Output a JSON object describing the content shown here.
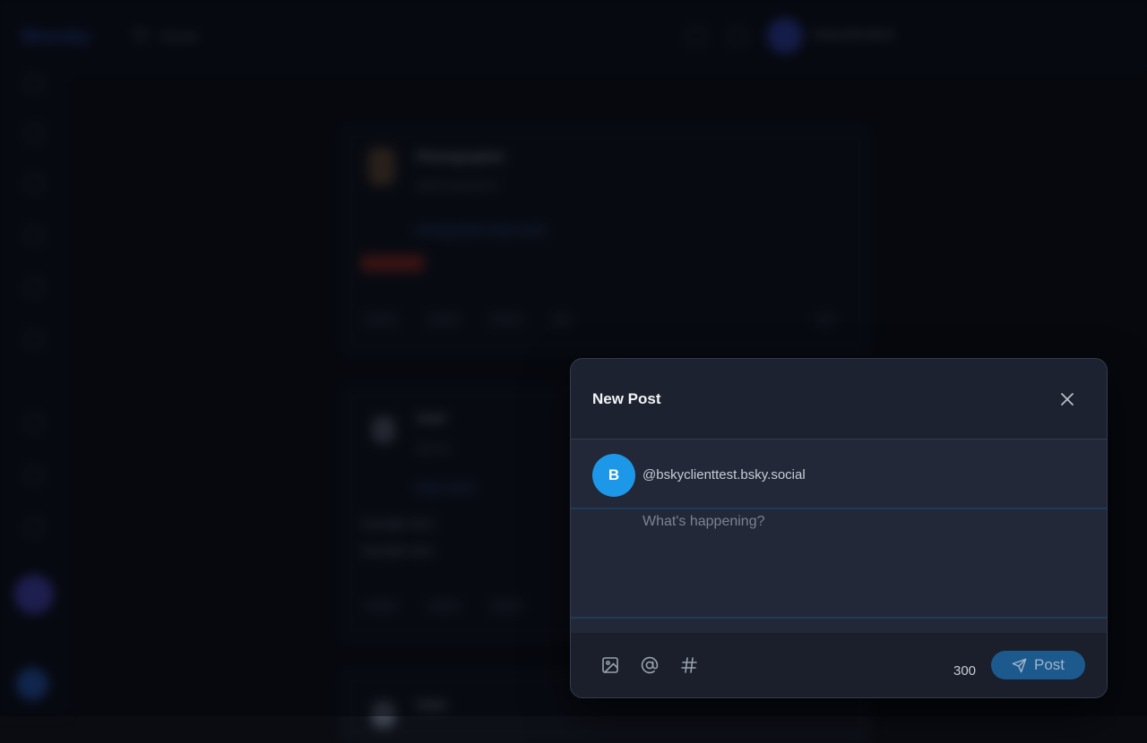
{
  "background": {
    "logo": "Bluesky",
    "breadcrumb": "Home",
    "user_name": "bskyclienttest",
    "posts": [
      {
        "author": "Photographer",
        "handle": "@photographer",
        "link": "photographer.bsky.social"
      },
      {
        "author": "User",
        "handle": "@user",
        "link": "bsky.social",
        "text_1": "Sample text",
        "text_2": "Sample text"
      },
      {
        "author": "User"
      }
    ]
  },
  "dialog": {
    "title": "New Post",
    "close_icon": "close-icon",
    "account": {
      "avatar_initial": "B",
      "handle": "@bskyclienttest.bsky.social"
    },
    "composer": {
      "placeholder": "What's happening?",
      "value": ""
    },
    "toolbar": {
      "image_icon": "image-icon",
      "mention_icon": "at-sign-icon",
      "hashtag_icon": "hashtag-icon"
    },
    "char_count": "300",
    "post_button": {
      "label": "Post",
      "icon": "send-icon"
    },
    "colors": {
      "accent": "#1d97e8",
      "post_button": "#1c5a8e",
      "dialog_bg": "#1d2230"
    }
  }
}
